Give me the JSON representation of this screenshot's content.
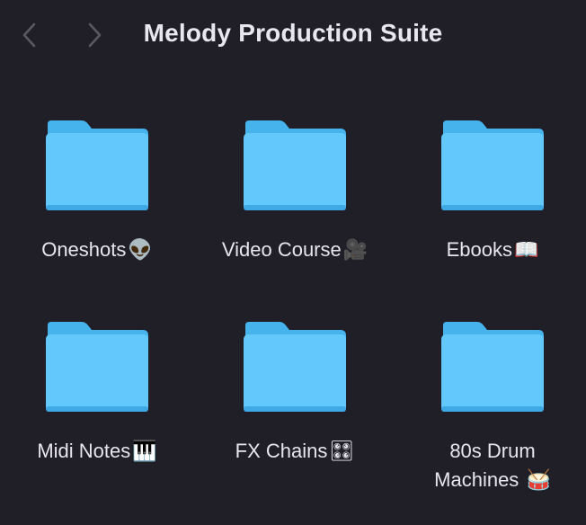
{
  "window": {
    "title": "Melody Production Suite",
    "background": "#201e27"
  },
  "toolbar": {
    "back_icon": "chevron-left-icon",
    "forward_icon": "chevron-right-icon"
  },
  "folder_color": {
    "back": "#47b3ec",
    "front": "#63c8fb",
    "front_dark": "#3fa9e6"
  },
  "items": [
    {
      "label": "Oneshots",
      "emoji": "👽",
      "icon": "folder-icon"
    },
    {
      "label": "Video Course",
      "emoji": "🎥",
      "icon": "folder-icon"
    },
    {
      "label": "Ebooks",
      "emoji": "📖",
      "icon": "folder-icon"
    },
    {
      "label": "Midi Notes",
      "emoji": "🎹",
      "icon": "folder-icon"
    },
    {
      "label": "FX Chains",
      "emoji": "🎛",
      "icon": "folder-icon"
    },
    {
      "label": "80s Drum Machines",
      "emoji": "🥁",
      "icon": "folder-icon"
    }
  ]
}
